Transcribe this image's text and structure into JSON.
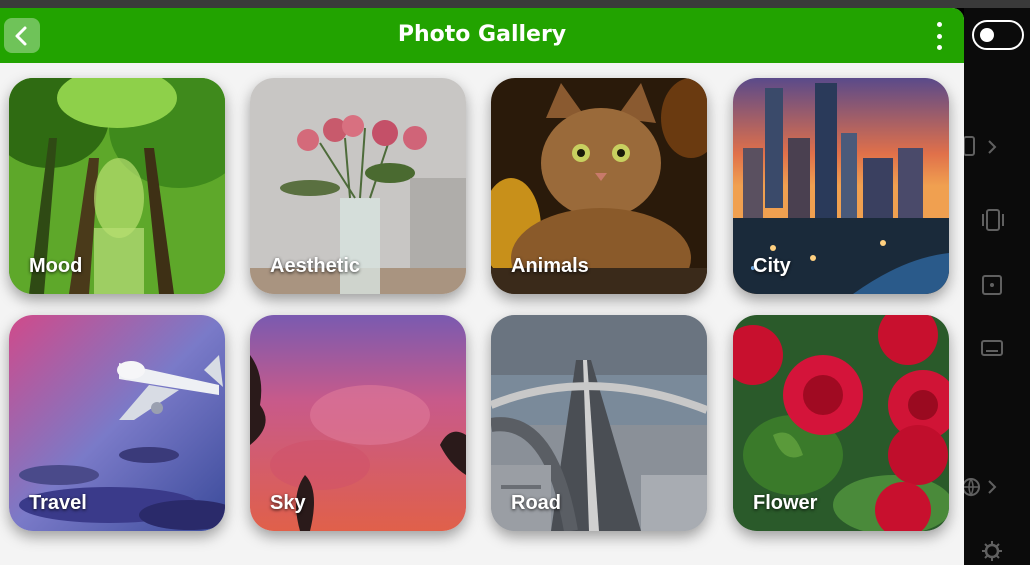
{
  "app": {
    "title": "Photo Gallery",
    "brand_color": "#22a300"
  },
  "toolbar": {
    "back_icon": "chevron-left-icon",
    "menu_icon": "more-vertical-icon"
  },
  "side_panel": {
    "toggle_state": "off",
    "icons": [
      "phone-icon",
      "vibrate-icon",
      "focus-icon",
      "keyboard-icon",
      "globe-icon",
      "settings-icon"
    ]
  },
  "gallery": {
    "categories": [
      {
        "label": "Mood"
      },
      {
        "label": "Aesthetic"
      },
      {
        "label": "Animals"
      },
      {
        "label": "City"
      },
      {
        "label": "Travel"
      },
      {
        "label": "Sky"
      },
      {
        "label": "Road"
      },
      {
        "label": "Flower"
      }
    ]
  }
}
